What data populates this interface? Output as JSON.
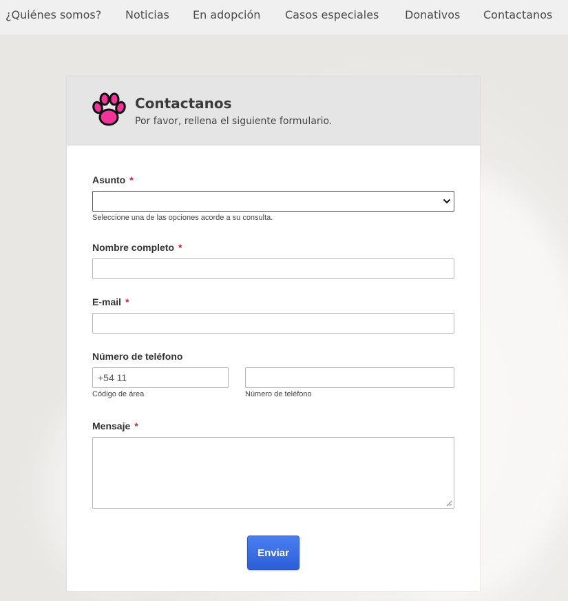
{
  "nav": {
    "items": [
      "¿Quiénes somos?",
      "Noticias",
      "En adopción",
      "Casos especiales",
      "Donativos",
      "Contactanos"
    ]
  },
  "form": {
    "title": "Contactanos",
    "subtitle": "Por favor, rellena el siguiente formulario.",
    "logo_icon": "paw-icon",
    "required_mark": "*",
    "subject": {
      "label": "Asunto",
      "value": "",
      "hint": "Seleccione una de las opciones acorde a su consulta."
    },
    "full_name": {
      "label": "Nombre completo",
      "value": ""
    },
    "email": {
      "label": "E-mail",
      "value": ""
    },
    "phone": {
      "label": "Número de teléfono",
      "area_code_value": "+54 11",
      "area_code_hint": "Código de área",
      "number_value": "",
      "number_hint": "Número de teléfono"
    },
    "message": {
      "label": "Mensaje",
      "value": ""
    },
    "submit_label": "Enviar"
  },
  "colors": {
    "accent": "#2c5fd8",
    "required": "#d6242a",
    "paw": "#f0359a"
  }
}
